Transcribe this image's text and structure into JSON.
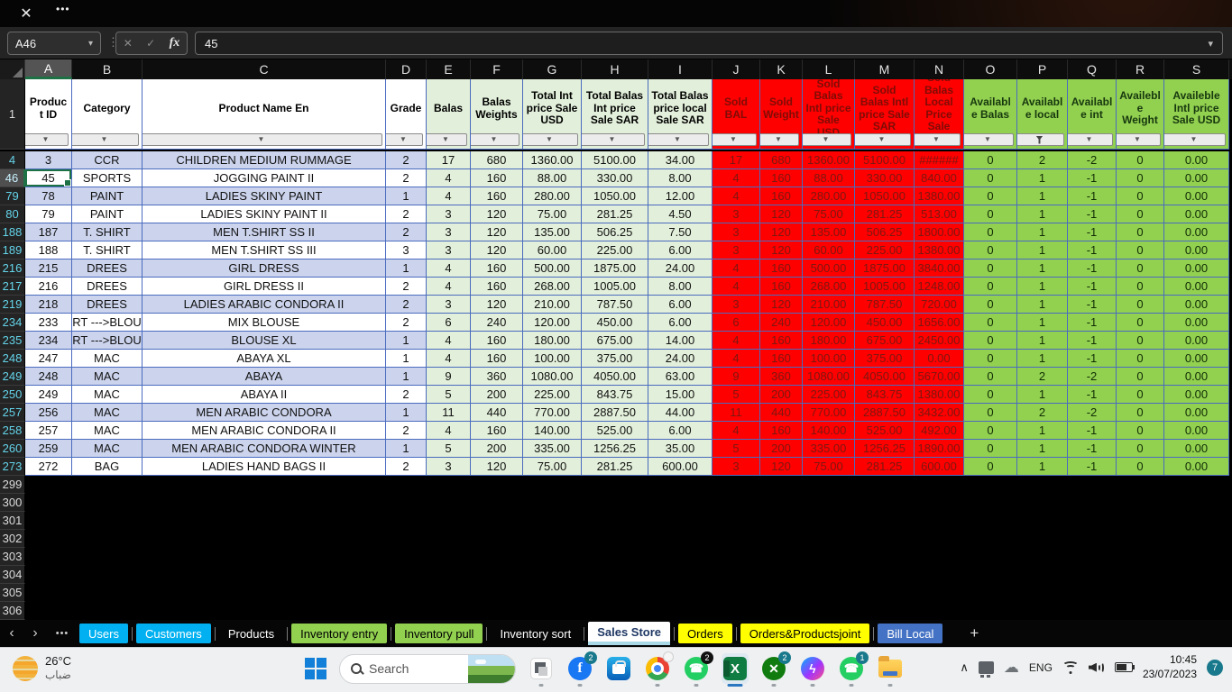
{
  "titlebar": {
    "close_glyph": "✕",
    "more_glyph": "•••"
  },
  "formula_bar": {
    "name_box": "A46",
    "cancel_glyph": "✕",
    "enter_glyph": "✓",
    "fx_label": "fx",
    "value": "45"
  },
  "colors": {
    "selection_green": "#1e7145",
    "gridline_blue": "#4a6bbf",
    "band_lavender": "#ccd4ed",
    "light_green_fill": "#e2efda",
    "red_fill": "#fe0000",
    "green_fill": "#92d050",
    "tab_blue": "#00b0f0",
    "tab_green": "#92d050",
    "tab_yellow": "#ffff00",
    "tab_navy": "#4472c4",
    "badge_teal": "#19798c"
  },
  "grid": {
    "selected_cell": {
      "row": "46",
      "col": "A"
    },
    "header_row_number": "1",
    "columns": [
      {
        "letter": "A",
        "label": "Product ID",
        "group": "g-plain",
        "selected": true
      },
      {
        "letter": "B",
        "label": "Category",
        "group": "g-plain"
      },
      {
        "letter": "C",
        "label": "Product Name En",
        "group": "g-plain"
      },
      {
        "letter": "D",
        "label": "Grade",
        "group": "g-plain"
      },
      {
        "letter": "E",
        "label": "Balas",
        "group": "g-lg"
      },
      {
        "letter": "F",
        "label": "Balas Weights",
        "group": "g-lg"
      },
      {
        "letter": "G",
        "label": "Total Int price Sale USD",
        "group": "g-lg"
      },
      {
        "letter": "H",
        "label": "Total Balas Int price Sale SAR",
        "group": "g-lg"
      },
      {
        "letter": "I",
        "label": "Total Balas price local Sale SAR",
        "group": "g-lg"
      },
      {
        "letter": "J",
        "label": "Sold BAL",
        "group": "g-red"
      },
      {
        "letter": "K",
        "label": "Sold Weight",
        "group": "g-red"
      },
      {
        "letter": "L",
        "label": "Sold Balas Intl price Sale USD",
        "group": "g-red"
      },
      {
        "letter": "M",
        "label": "Sold Balas Intl price Sale SAR",
        "group": "g-red"
      },
      {
        "letter": "N",
        "label": "Sold Balas Local Price Sale SAR",
        "group": "g-red"
      },
      {
        "letter": "O",
        "label": "Available Balas",
        "group": "g-grn"
      },
      {
        "letter": "P",
        "label": "Available local",
        "group": "g-grn",
        "filtered": true
      },
      {
        "letter": "Q",
        "label": "Available int",
        "group": "g-grn"
      },
      {
        "letter": "R",
        "label": "Availeble Weight",
        "group": "g-grn"
      },
      {
        "letter": "S",
        "label": "Availeble Intl price Sale USD",
        "group": "g-grn"
      }
    ],
    "rows": [
      {
        "n": "4",
        "cells": [
          "3",
          "CCR",
          "CHILDREN MEDIUM RUMMAGE",
          "2",
          "17",
          "680",
          "1360.00",
          "5100.00",
          "34.00",
          "17",
          "680",
          "1360.00",
          "5100.00",
          "######",
          "0",
          "2",
          "-2",
          "0",
          "0.00"
        ]
      },
      {
        "n": "46",
        "selected": true,
        "cells": [
          "45",
          "SPORTS",
          "JOGGING PAINT II",
          "2",
          "4",
          "160",
          "88.00",
          "330.00",
          "8.00",
          "4",
          "160",
          "88.00",
          "330.00",
          "840.00",
          "0",
          "1",
          "-1",
          "0",
          "0.00"
        ]
      },
      {
        "n": "79",
        "cells": [
          "78",
          "PAINT",
          "LADIES SKINY PAINT",
          "1",
          "4",
          "160",
          "280.00",
          "1050.00",
          "12.00",
          "4",
          "160",
          "280.00",
          "1050.00",
          "1380.00",
          "0",
          "1",
          "-1",
          "0",
          "0.00"
        ]
      },
      {
        "n": "80",
        "cells": [
          "79",
          "PAINT",
          "LADIES SKINY PAINT II",
          "2",
          "3",
          "120",
          "75.00",
          "281.25",
          "4.50",
          "3",
          "120",
          "75.00",
          "281.25",
          "513.00",
          "0",
          "1",
          "-1",
          "0",
          "0.00"
        ]
      },
      {
        "n": "188",
        "cells": [
          "187",
          "T. SHIRT",
          "MEN T.SHIRT SS II",
          "2",
          "3",
          "120",
          "135.00",
          "506.25",
          "7.50",
          "3",
          "120",
          "135.00",
          "506.25",
          "1800.00",
          "0",
          "1",
          "-1",
          "0",
          "0.00"
        ]
      },
      {
        "n": "189",
        "cells": [
          "188",
          "T. SHIRT",
          "MEN T.SHIRT SS III",
          "3",
          "3",
          "120",
          "60.00",
          "225.00",
          "6.00",
          "3",
          "120",
          "60.00",
          "225.00",
          "1380.00",
          "0",
          "1",
          "-1",
          "0",
          "0.00"
        ]
      },
      {
        "n": "216",
        "cells": [
          "215",
          "DREES",
          "GIRL DRESS",
          "1",
          "4",
          "160",
          "500.00",
          "1875.00",
          "24.00",
          "4",
          "160",
          "500.00",
          "1875.00",
          "3840.00",
          "0",
          "1",
          "-1",
          "0",
          "0.00"
        ]
      },
      {
        "n": "217",
        "cells": [
          "216",
          "DREES",
          "GIRL DRESS II",
          "2",
          "4",
          "160",
          "268.00",
          "1005.00",
          "8.00",
          "4",
          "160",
          "268.00",
          "1005.00",
          "1248.00",
          "0",
          "1",
          "-1",
          "0",
          "0.00"
        ]
      },
      {
        "n": "219",
        "cells": [
          "218",
          "DREES",
          "LADIES ARABIC CONDORA II",
          "2",
          "3",
          "120",
          "210.00",
          "787.50",
          "6.00",
          "3",
          "120",
          "210.00",
          "787.50",
          "720.00",
          "0",
          "1",
          "-1",
          "0",
          "0.00"
        ]
      },
      {
        "n": "234",
        "cells": [
          "233",
          "RT --->BLOU",
          "MIX BLOUSE",
          "2",
          "6",
          "240",
          "120.00",
          "450.00",
          "6.00",
          "6",
          "240",
          "120.00",
          "450.00",
          "1656.00",
          "0",
          "1",
          "-1",
          "0",
          "0.00"
        ]
      },
      {
        "n": "235",
        "cells": [
          "234",
          "RT --->BLOU",
          "BLOUSE XL",
          "1",
          "4",
          "160",
          "180.00",
          "675.00",
          "14.00",
          "4",
          "160",
          "180.00",
          "675.00",
          "2450.00",
          "0",
          "1",
          "-1",
          "0",
          "0.00"
        ]
      },
      {
        "n": "248",
        "cells": [
          "247",
          "MAC",
          "ABAYA XL",
          "1",
          "4",
          "160",
          "100.00",
          "375.00",
          "24.00",
          "4",
          "160",
          "100.00",
          "375.00",
          "0.00",
          "0",
          "1",
          "-1",
          "0",
          "0.00"
        ]
      },
      {
        "n": "249",
        "cells": [
          "248",
          "MAC",
          "ABAYA",
          "1",
          "9",
          "360",
          "1080.00",
          "4050.00",
          "63.00",
          "9",
          "360",
          "1080.00",
          "4050.00",
          "5670.00",
          "0",
          "2",
          "-2",
          "0",
          "0.00"
        ]
      },
      {
        "n": "250",
        "cells": [
          "249",
          "MAC",
          "ABAYA II",
          "2",
          "5",
          "200",
          "225.00",
          "843.75",
          "15.00",
          "5",
          "200",
          "225.00",
          "843.75",
          "1380.00",
          "0",
          "1",
          "-1",
          "0",
          "0.00"
        ]
      },
      {
        "n": "257",
        "cells": [
          "256",
          "MAC",
          "MEN ARABIC CONDORA",
          "1",
          "11",
          "440",
          "770.00",
          "2887.50",
          "44.00",
          "11",
          "440",
          "770.00",
          "2887.50",
          "3432.00",
          "0",
          "2",
          "-2",
          "0",
          "0.00"
        ]
      },
      {
        "n": "258",
        "cells": [
          "257",
          "MAC",
          "MEN ARABIC CONDORA II",
          "2",
          "4",
          "160",
          "140.00",
          "525.00",
          "6.00",
          "4",
          "160",
          "140.00",
          "525.00",
          "492.00",
          "0",
          "1",
          "-1",
          "0",
          "0.00"
        ]
      },
      {
        "n": "260",
        "cells": [
          "259",
          "MAC",
          "MEN ARABIC CONDORA WINTER",
          "1",
          "5",
          "200",
          "335.00",
          "1256.25",
          "35.00",
          "5",
          "200",
          "335.00",
          "1256.25",
          "1890.00",
          "0",
          "1",
          "-1",
          "0",
          "0.00"
        ]
      },
      {
        "n": "273",
        "cells": [
          "272",
          "BAG",
          "LADIES HAND BAGS II",
          "2",
          "3",
          "120",
          "75.00",
          "281.25",
          "600.00",
          "3",
          "120",
          "75.00",
          "281.25",
          "600.00",
          "0",
          "1",
          "-1",
          "0",
          "0.00"
        ]
      }
    ],
    "empty_row_numbers": [
      "299",
      "300",
      "301",
      "302",
      "303",
      "304",
      "305",
      "306"
    ]
  },
  "tabs": {
    "nav_prev": "‹",
    "nav_next": "›",
    "nav_more": "•••",
    "add_label": "+",
    "items": [
      {
        "label": "Users",
        "bg": "#00b0f0",
        "color": "#ffffff"
      },
      {
        "label": "Customers",
        "bg": "#00b0f0",
        "color": "#ffffff"
      },
      {
        "label": "Products",
        "bg": "",
        "color": "#ffffff"
      },
      {
        "label": "Inventory entry",
        "bg": "#92d050",
        "color": "#000000"
      },
      {
        "label": "Inventory pull",
        "bg": "#92d050",
        "color": "#000000"
      },
      {
        "label": "Inventory sort",
        "bg": "",
        "color": "#ffffff"
      },
      {
        "label": "Sales Store",
        "bg": "#ffffff",
        "color": "#1f3864",
        "active": true
      },
      {
        "label": "Orders",
        "bg": "#ffff00",
        "color": "#000000"
      },
      {
        "label": "Orders&Productsjoint",
        "bg": "#ffff00",
        "color": "#000000"
      },
      {
        "label": "Bill Local",
        "bg": "#4472c4",
        "color": "#ffffff"
      }
    ]
  },
  "taskbar": {
    "weather": {
      "temp": "26°C",
      "desc": "ضباب"
    },
    "search": {
      "placeholder": "Search"
    },
    "badges": {
      "facebook": "2",
      "whatsapp_1": "2",
      "xbox": "2",
      "whatsapp_2": "1"
    },
    "excel_label": "X",
    "tray": {
      "language": "ENG",
      "time": "10:45",
      "date": "23/07/2023",
      "notification_count": "7"
    }
  }
}
